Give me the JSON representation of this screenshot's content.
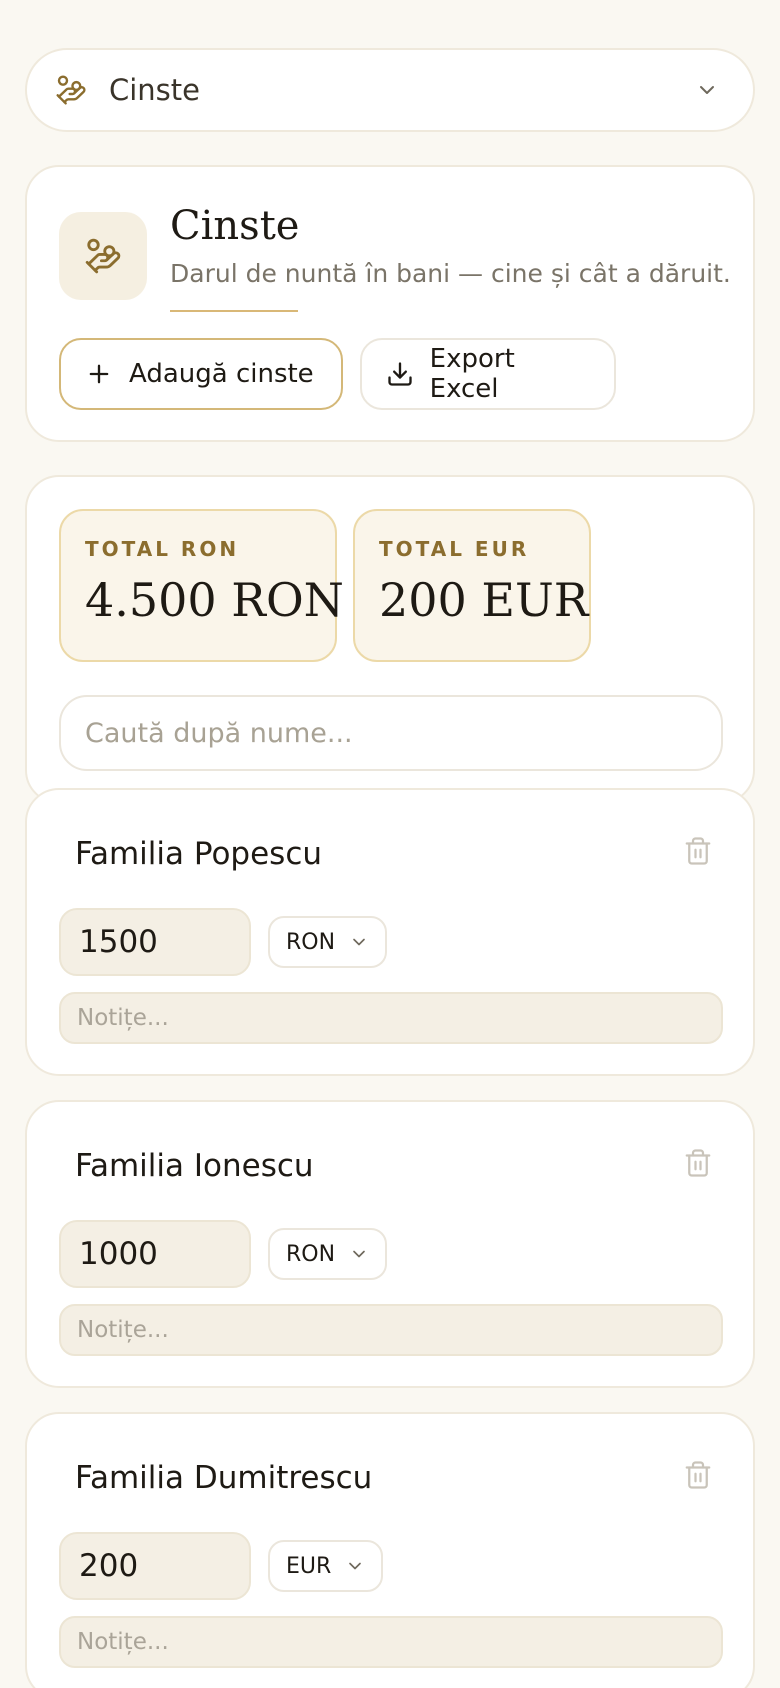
{
  "selector": {
    "label": "Cinste",
    "icon": "hand-coins-icon"
  },
  "header": {
    "title": "Cinste",
    "subtitle": "Darul de nuntă în bani — cine și cât a dăruit.",
    "add_button": "Adaugă cinste",
    "export_button": "Export Excel"
  },
  "totals": {
    "ron_label": "TOTAL RON",
    "ron_value": "4.500 RON",
    "eur_label": "TOTAL EUR",
    "eur_value": "200 EUR"
  },
  "search": {
    "placeholder": "Caută după nume..."
  },
  "gifts": [
    {
      "name": "Familia Popescu",
      "amount": "1500",
      "currency": "RON",
      "notes_placeholder": "Notițe..."
    },
    {
      "name": "Familia Ionescu",
      "amount": "1000",
      "currency": "RON",
      "notes_placeholder": "Notițe..."
    },
    {
      "name": "Familia Dumitrescu",
      "amount": "200",
      "currency": "EUR",
      "notes_placeholder": "Notițe..."
    }
  ],
  "colors": {
    "background": "#faf8f2",
    "accent": "#8b6d2e",
    "accent_border": "#d4b878"
  }
}
